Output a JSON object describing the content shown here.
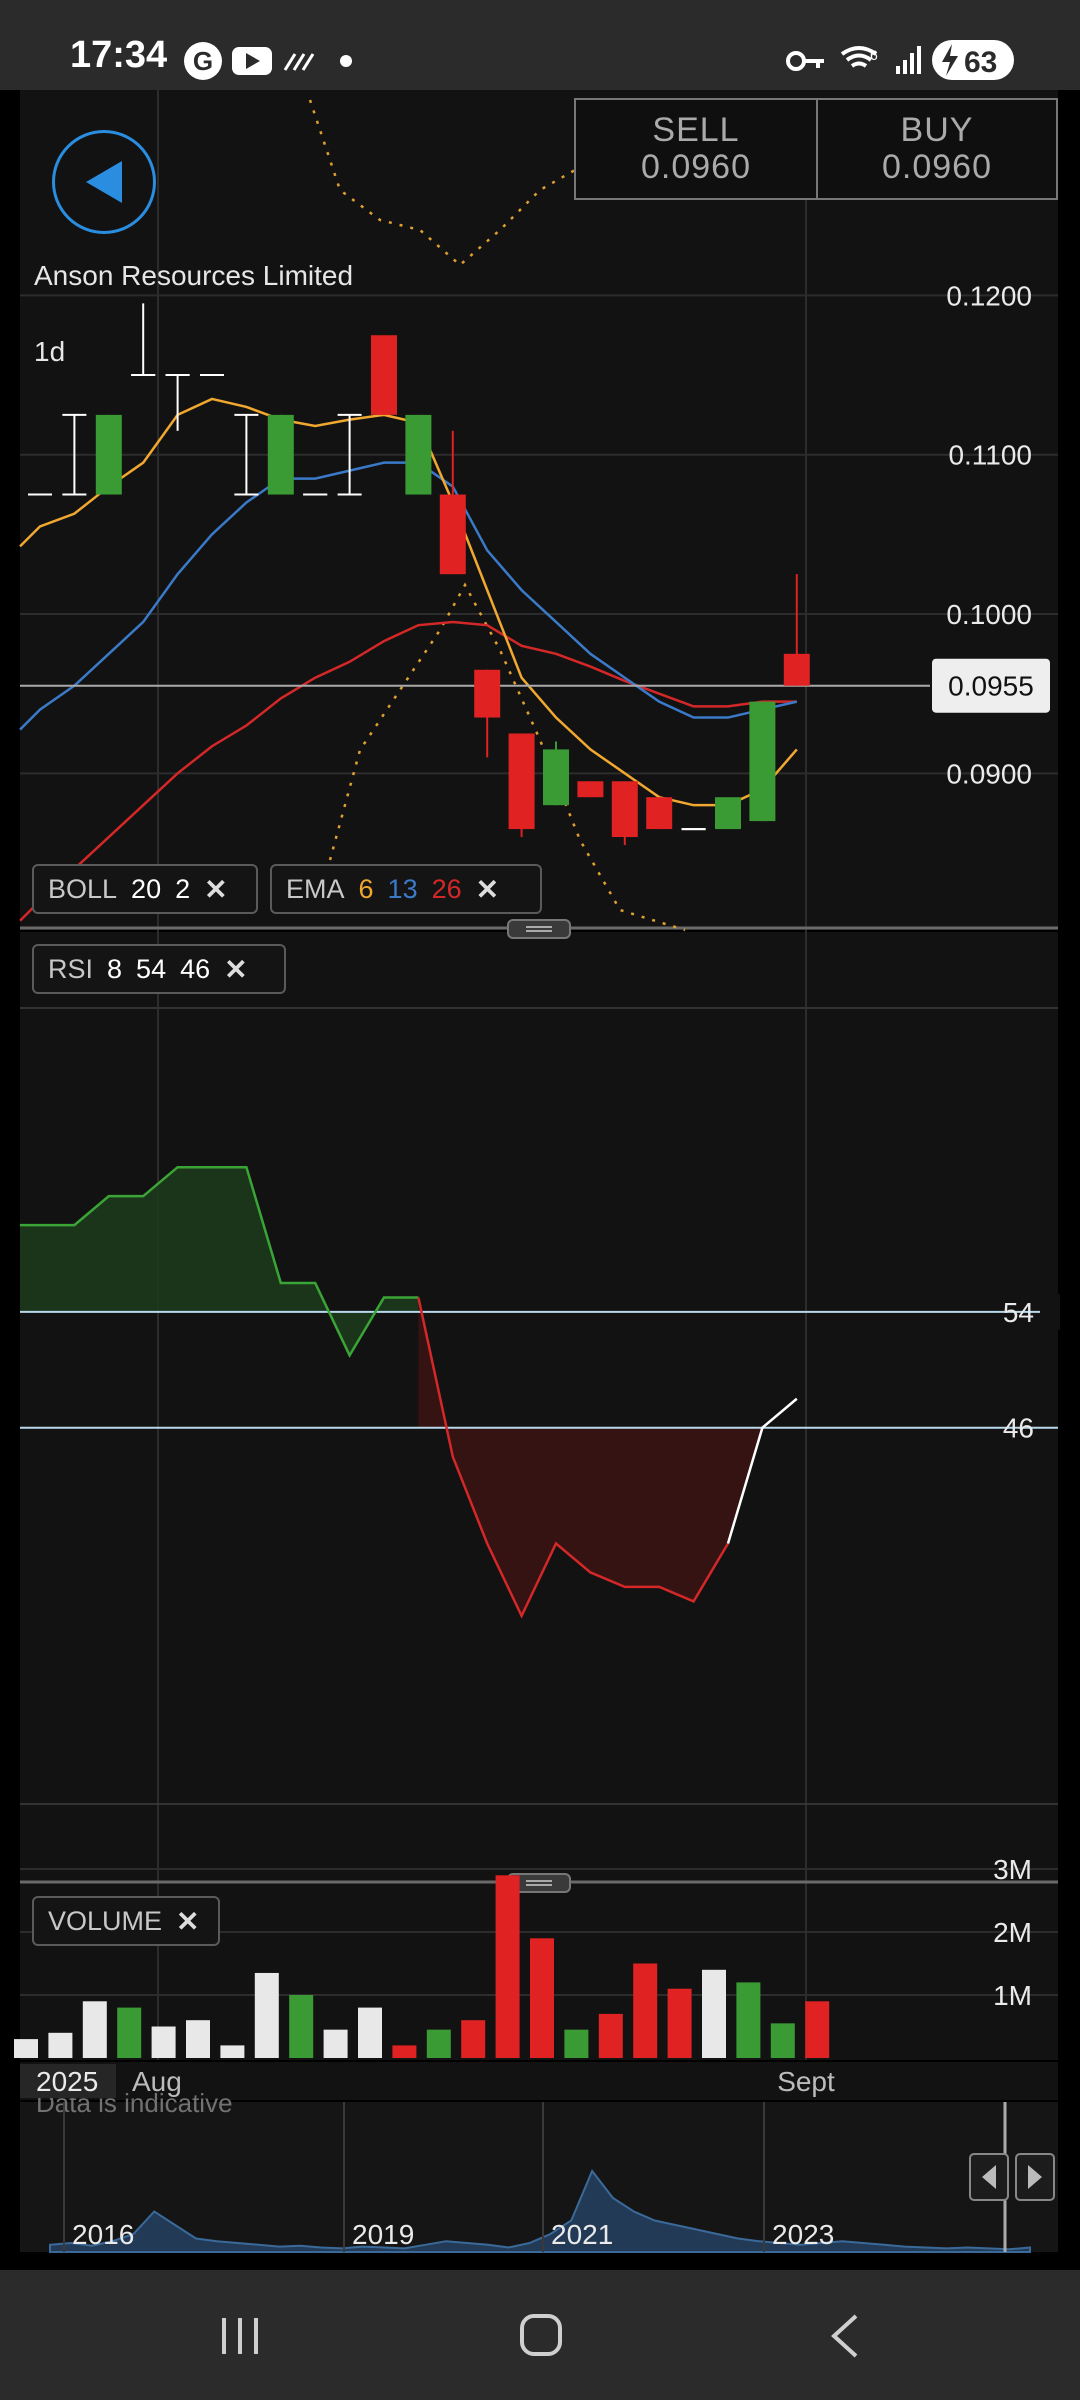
{
  "status_bar": {
    "time": "17:34",
    "icons": [
      "g-icon",
      "youtube-icon",
      "signal-stripes-icon",
      "dot-icon"
    ],
    "right_icons": [
      "key-icon",
      "wifi-6-icon",
      "cell-signal-icon"
    ],
    "battery": "63"
  },
  "header": {
    "back_button": "back-arrow-icon",
    "sell_label": "SELL",
    "sell_value": "0.0960",
    "buy_label": "BUY",
    "buy_value": "0.0960"
  },
  "main_chart": {
    "company": "Anson Resources Limited",
    "interval": "1d",
    "y_ticks": [
      "0.1200",
      "0.1100",
      "0.1000",
      "0.0900"
    ],
    "current_price": "0.0955",
    "colors": {
      "up": "#3a9b35",
      "down": "#e02222",
      "ema6": "#f0a830",
      "ema13": "#3a7ac8",
      "ema26": "#d42828",
      "boll": "#e0a030"
    }
  },
  "indicators": {
    "boll": {
      "label": "BOLL",
      "p1": "20",
      "p2": "2"
    },
    "ema": {
      "label": "EMA",
      "p1": "6",
      "p2": "13",
      "p3": "26"
    },
    "rsi": {
      "label": "RSI",
      "p1": "8",
      "p2": "54",
      "p3": "46"
    },
    "volume": {
      "label": "VOLUME"
    }
  },
  "rsi_panel": {
    "level_high": "54",
    "level_low": "46"
  },
  "volume_panel": {
    "y_ticks": [
      "3M",
      "2M",
      "1M"
    ],
    "watermark": "Data is indicative"
  },
  "time_axis": {
    "year": "2025",
    "month1": "Aug",
    "month2": "Sept"
  },
  "navigator": {
    "years": [
      "2016",
      "2019",
      "2021",
      "2023"
    ]
  },
  "chart_data": {
    "type": "candlestick",
    "x_labels": [
      "Aug",
      "Sept"
    ],
    "y_range": [
      0.0855,
      0.1285
    ],
    "candles": [
      {
        "o": 0.1075,
        "h": 0.1075,
        "l": 0.1075,
        "c": 0.1075,
        "color": "doji"
      },
      {
        "o": 0.1075,
        "h": 0.1125,
        "l": 0.1075,
        "c": 0.1125,
        "color": "doji"
      },
      {
        "o": 0.1075,
        "h": 0.1125,
        "l": 0.1075,
        "c": 0.1125,
        "color": "up"
      },
      {
        "o": 0.115,
        "h": 0.1195,
        "l": 0.115,
        "c": 0.115,
        "color": "doji"
      },
      {
        "o": 0.115,
        "h": 0.115,
        "l": 0.1115,
        "c": 0.115,
        "color": "doji"
      },
      {
        "o": 0.115,
        "h": 0.115,
        "l": 0.115,
        "c": 0.115,
        "color": "doji"
      },
      {
        "o": 0.1075,
        "h": 0.1125,
        "l": 0.1075,
        "c": 0.1125,
        "color": "doji"
      },
      {
        "o": 0.1075,
        "h": 0.1125,
        "l": 0.1075,
        "c": 0.1125,
        "color": "up"
      },
      {
        "o": 0.1075,
        "h": 0.1075,
        "l": 0.1075,
        "c": 0.1075,
        "color": "doji"
      },
      {
        "o": 0.1125,
        "h": 0.1125,
        "l": 0.1075,
        "c": 0.1075,
        "color": "doji"
      },
      {
        "o": 0.1175,
        "h": 0.1175,
        "l": 0.1125,
        "c": 0.1125,
        "color": "down"
      },
      {
        "o": 0.1075,
        "h": 0.1125,
        "l": 0.1075,
        "c": 0.1125,
        "color": "up"
      },
      {
        "o": 0.1075,
        "h": 0.1115,
        "l": 0.1025,
        "c": 0.1025,
        "color": "down"
      },
      {
        "o": 0.0965,
        "h": 0.0965,
        "l": 0.091,
        "c": 0.0935,
        "color": "down"
      },
      {
        "o": 0.0925,
        "h": 0.0925,
        "l": 0.086,
        "c": 0.0865,
        "color": "down"
      },
      {
        "o": 0.088,
        "h": 0.092,
        "l": 0.088,
        "c": 0.0915,
        "color": "up"
      },
      {
        "o": 0.0895,
        "h": 0.0895,
        "l": 0.0885,
        "c": 0.0885,
        "color": "down"
      },
      {
        "o": 0.0895,
        "h": 0.0895,
        "l": 0.0855,
        "c": 0.086,
        "color": "down"
      },
      {
        "o": 0.0885,
        "h": 0.0885,
        "l": 0.0865,
        "c": 0.0865,
        "color": "down"
      },
      {
        "o": 0.0865,
        "h": 0.0865,
        "l": 0.0865,
        "c": 0.0865,
        "color": "doji"
      },
      {
        "o": 0.0865,
        "h": 0.0885,
        "l": 0.0865,
        "c": 0.0885,
        "color": "up"
      },
      {
        "o": 0.087,
        "h": 0.0945,
        "l": 0.087,
        "c": 0.0945,
        "color": "up"
      },
      {
        "o": 0.0975,
        "h": 0.1025,
        "l": 0.0955,
        "c": 0.0955,
        "color": "down"
      }
    ],
    "ema6": [
      0.1055,
      0.1063,
      0.108,
      0.1095,
      0.1125,
      0.1135,
      0.113,
      0.1122,
      0.1118,
      0.1122,
      0.1125,
      0.112,
      0.107,
      0.1015,
      0.096,
      0.0935,
      0.0915,
      0.09,
      0.0885,
      0.088,
      0.088,
      0.089,
      0.0915
    ],
    "ema13": [
      0.094,
      0.0955,
      0.0975,
      0.0995,
      0.1025,
      0.105,
      0.107,
      0.1085,
      0.1085,
      0.109,
      0.1095,
      0.1095,
      0.108,
      0.104,
      0.1015,
      0.0995,
      0.0975,
      0.096,
      0.0945,
      0.0935,
      0.0935,
      0.094,
      0.0945
    ],
    "ema26": [
      0.082,
      0.084,
      0.086,
      0.088,
      0.09,
      0.0917,
      0.093,
      0.0947,
      0.096,
      0.097,
      0.0983,
      0.0993,
      0.0995,
      0.0993,
      0.098,
      0.0975,
      0.0967,
      0.0958,
      0.095,
      0.0942,
      0.0942,
      0.0945,
      0.0945
    ],
    "rsi": [
      60,
      60,
      62,
      62,
      64,
      64,
      64,
      56,
      56,
      51,
      55,
      55,
      44,
      38,
      33,
      38,
      36,
      35,
      35,
      34,
      38,
      46,
      48
    ],
    "volume_millions": [
      0.3,
      0.4,
      0.9,
      0.8,
      0.5,
      0.6,
      0.2,
      1.35,
      1.0,
      0.45,
      0.8,
      0.2,
      0.45,
      0.6,
      2.9,
      1.9,
      0.45,
      0.7,
      1.5,
      1.1,
      1.4,
      1.2,
      0.55,
      0.9
    ],
    "volume_colors": [
      "white",
      "white",
      "white",
      "up",
      "white",
      "white",
      "white",
      "white",
      "up",
      "white",
      "white",
      "down",
      "up",
      "down",
      "down",
      "down",
      "up",
      "down",
      "down",
      "down",
      "white",
      "up",
      "up",
      "down"
    ]
  }
}
